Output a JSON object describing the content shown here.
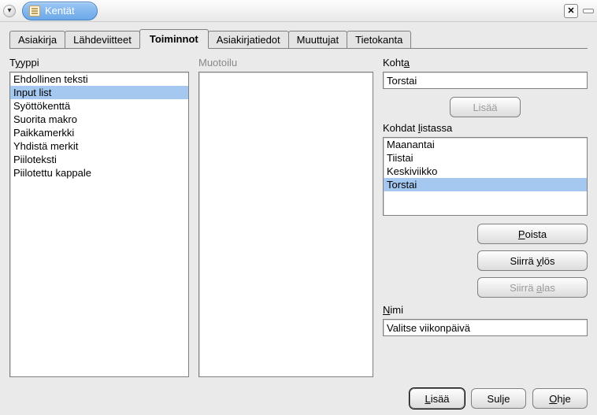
{
  "window": {
    "title": "Kentät"
  },
  "tabs": [
    {
      "label": "Asiakirja"
    },
    {
      "label": "Lähdeviitteet"
    },
    {
      "label": "Toiminnot",
      "active": true
    },
    {
      "label": "Asiakirjatiedot"
    },
    {
      "label": "Muuttujat"
    },
    {
      "label": "Tietokanta"
    }
  ],
  "labels": {
    "tyyppi_pre": "T",
    "tyyppi_u": "y",
    "tyyppi_post": "yppi",
    "muotoilu": "Muotoilu",
    "kohta_pre": "Koht",
    "kohta_u": "a",
    "lisaa": "Lisää",
    "kohdat_pre": "Kohdat ",
    "kohdat_u": "l",
    "kohdat_post": "istassa",
    "poista_pre": "",
    "poista_u": "P",
    "poista_post": "oista",
    "siirrayl_pre": "Siirrä ",
    "siirrayl_u": "y",
    "siirrayl_post": "lös",
    "siirraal_pre": "Siirrä ",
    "siirraal_u": "a",
    "siirraal_post": "las",
    "nimi_pre": "",
    "nimi_u": "N",
    "nimi_post": "imi"
  },
  "type_list": {
    "items": [
      "Ehdollinen teksti",
      "Input list",
      "Syöttökenttä",
      "Suorita makro",
      "Paikkamerkki",
      "Yhdistä merkit",
      "Piiloteksti",
      "Piilotettu kappale"
    ],
    "selected_index": 1
  },
  "kohta_value": "Torstai",
  "kohdat": {
    "items": [
      "Maanantai",
      "Tiistai",
      "Keskiviikko",
      "Torstai"
    ],
    "selected_index": 3
  },
  "nimi_value": "Valitse viikonpäivä",
  "footer": {
    "lisaa_pre": "",
    "lisaa_u": "L",
    "lisaa_post": "isää",
    "sulje": "Sulje",
    "ohje_pre": "",
    "ohje_u": "O",
    "ohje_post": "hje"
  }
}
